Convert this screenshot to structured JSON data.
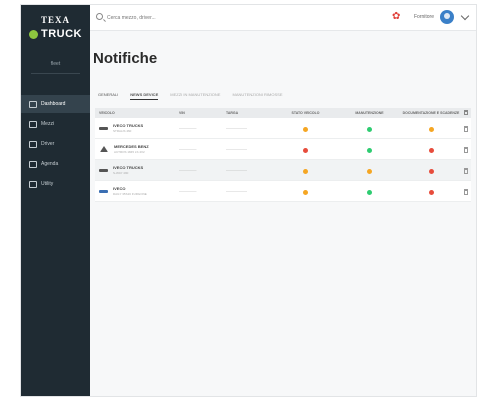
{
  "brand": {
    "top": "TEXA",
    "name": "TRUCK",
    "sub": "fleet"
  },
  "sidebar": {
    "items": [
      {
        "label": "Dashboard",
        "icon": "dashboard-icon",
        "active": true
      },
      {
        "label": "Mezzi",
        "icon": "vehicle-icon",
        "active": false
      },
      {
        "label": "Driver",
        "icon": "driver-icon",
        "active": false
      },
      {
        "label": "Agenda",
        "icon": "calendar-icon",
        "active": false
      },
      {
        "label": "Utility",
        "icon": "utility-icon",
        "active": false
      }
    ]
  },
  "header": {
    "search_placeholder": "Cerca mezzo, driver...",
    "user": "Fornitore",
    "accent": "#3b80c8"
  },
  "main": {
    "title": "Notifiche",
    "tabs": [
      {
        "label": "GENERALI",
        "state": "normal"
      },
      {
        "label": "NEWS DEVICE",
        "state": "active"
      },
      {
        "label": "MEZZI IN MANUTENZIONE",
        "state": "muted"
      },
      {
        "label": "MANUTENZIONI RIMOSSE",
        "state": "muted"
      }
    ],
    "table": {
      "headers": [
        "VEICOLO",
        "VIN",
        "TARGA",
        "STATO VEICOLO",
        "MANUTENZIONE",
        "DOCUMENTAZIONE E SCADENZE",
        ""
      ],
      "rows": [
        {
          "icon": "truck-icon",
          "icon_style": "dark",
          "name": "IVECO TRUCKS",
          "sub": "STRALIS 460",
          "vin": "—————",
          "plate": "——————",
          "s1": "orange",
          "s2": "green",
          "s3": "orange"
        },
        {
          "icon": "warning-truck-icon",
          "icon_style": "tri",
          "name": "MERCEDES BENZ",
          "sub": "ACTROS 1845 LS 4X2",
          "vin": "—————",
          "plate": "——————",
          "s1": "red",
          "s2": "green",
          "s3": "red"
        },
        {
          "icon": "truck-icon",
          "icon_style": "dark",
          "name": "IVECO TRUCKS",
          "sub": "S-WAY 490",
          "vin": "—————",
          "plate": "——————",
          "s1": "orange",
          "s2": "orange",
          "s3": "red"
        },
        {
          "icon": "van-icon",
          "icon_style": "blue",
          "name": "IVECO",
          "sub": "DAILY 35S16 FURGONE",
          "vin": "—————",
          "plate": "——————",
          "s1": "orange",
          "s2": "green",
          "s3": "red"
        }
      ]
    }
  }
}
